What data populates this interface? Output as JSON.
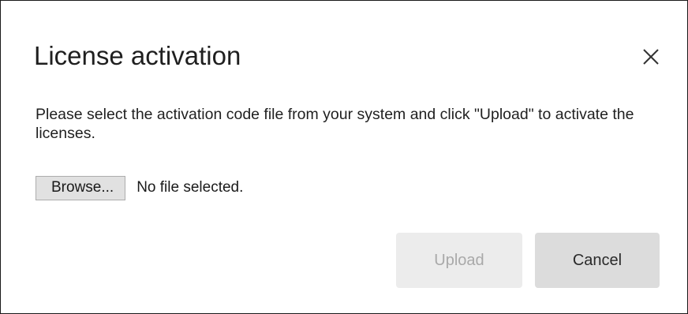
{
  "dialog": {
    "title": "License activation",
    "close_icon": "close-icon",
    "message": "Please select the activation code file from your system and click \"Upload\" to activate the licenses.",
    "file_input": {
      "browse_label": "Browse...",
      "status": "No file selected."
    },
    "buttons": {
      "upload_label": "Upload",
      "upload_disabled": true,
      "cancel_label": "Cancel"
    }
  }
}
